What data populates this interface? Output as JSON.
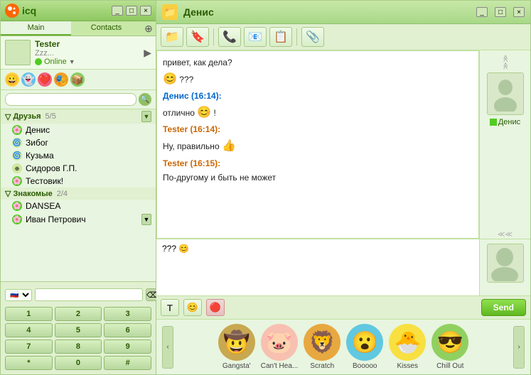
{
  "app": {
    "title": "icq",
    "logo_text": "icq"
  },
  "left_panel": {
    "tabs": [
      {
        "id": "main",
        "label": "Main"
      },
      {
        "id": "contacts",
        "label": "Contacts"
      }
    ],
    "user": {
      "name": "Tester",
      "status_text": "Zzz...",
      "status": "Online"
    },
    "emoticons": [
      "😀",
      "👻",
      "❤️",
      "🎭",
      "📦"
    ],
    "search": {
      "placeholder": ""
    },
    "groups": [
      {
        "name": "Друзья",
        "count": "5/5",
        "contacts": [
          {
            "name": "Денис",
            "status": "online"
          },
          {
            "name": "Зибог",
            "status": "offline"
          },
          {
            "name": "Кузьма",
            "status": "offline"
          },
          {
            "name": "Сидоров Г.П.",
            "status": "offline"
          },
          {
            "name": "Тестовик!",
            "status": "online"
          }
        ]
      },
      {
        "name": "Знакомые",
        "count": "2/4",
        "contacts": [
          {
            "name": "DANSEA",
            "status": "online"
          },
          {
            "name": "Иван Петрович",
            "status": "online"
          }
        ]
      }
    ],
    "dialer": {
      "country": "7",
      "buttons": [
        "1",
        "2",
        "3",
        "4",
        "5",
        "6",
        "7",
        "8",
        "9",
        "*",
        "0",
        "#"
      ]
    }
  },
  "right_panel": {
    "title": "Денис",
    "toolbar_buttons": [
      "📁",
      "🔖",
      "📞",
      "📧",
      "📋",
      "📎"
    ],
    "messages": [
      {
        "type": "incoming",
        "text": "привет, как дела?"
      },
      {
        "type": "incoming",
        "text": "???",
        "emoji": "😊"
      },
      {
        "type": "sender",
        "sender": "Денис (16:14):",
        "text": "отлично",
        "emoji": "😊",
        "suffix": "!"
      },
      {
        "type": "sender",
        "sender": "Tester (16:14):",
        "text": "Ну, правильно",
        "emoji": "👍"
      },
      {
        "type": "sender",
        "sender": "Tester (16:15):",
        "text": "По-другому и быть не может"
      }
    ],
    "input_text": "??? 😊",
    "send_button": "Send",
    "contact_name": "Денис",
    "emoticon_panel": {
      "items": [
        {
          "label": "Gangsta'",
          "emoji": "🤠"
        },
        {
          "label": "Can't Hea...",
          "emoji": "🐷"
        },
        {
          "label": "Scratch",
          "emoji": "🦁"
        },
        {
          "label": "Booooo",
          "emoji": "😮"
        },
        {
          "label": "Kisses",
          "emoji": "🐣"
        },
        {
          "label": "Chill Out",
          "emoji": "😎"
        }
      ]
    },
    "input_toolbar": {
      "text_btn": "T",
      "emoji_btn": "😊",
      "record_btn": "🔴"
    }
  }
}
